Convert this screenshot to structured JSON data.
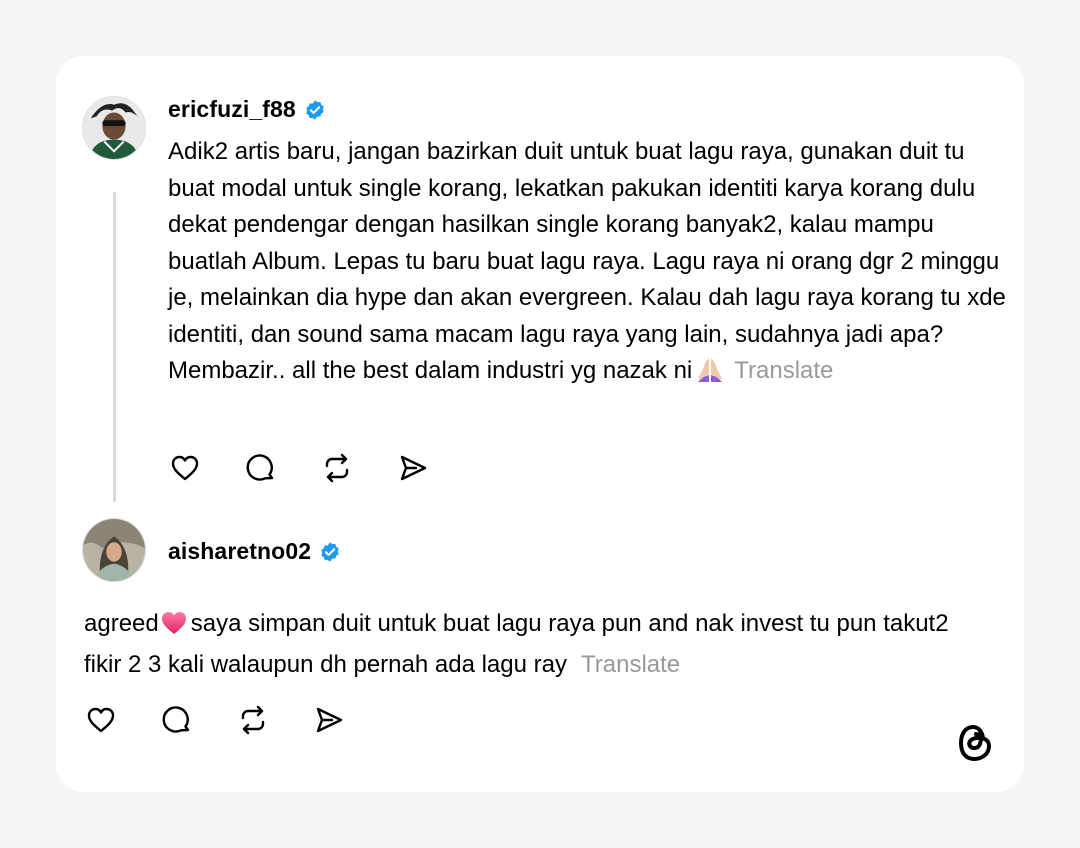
{
  "post": {
    "username": "ericfuzi_f88",
    "text": "Adik2 artis baru, jangan bazirkan duit untuk buat lagu raya, gunakan duit tu buat modal untuk single korang, lekatkan pakukan identiti karya korang dulu dekat pendengar dengan hasilkan single korang banyak2, kalau mampu buatlah Album. Lepas tu baru buat lagu raya. Lagu raya ni orang dgr 2 minggu je, melainkan dia hype dan akan evergreen. Kalau dah lagu raya korang tu xde identiti, dan sound sama macam lagu raya yang lain, sudahnya jadi apa? Membazir.. all the best dalam industri yg nazak ni",
    "emoji": "🙏🏻",
    "translate_label": "Translate"
  },
  "reply": {
    "username": "aisharetno02",
    "text_before_emoji": "agreed",
    "emoji": "💗",
    "text_after_emoji": "saya simpan duit untuk buat lagu raya pun and nak invest tu pun takut2 fikir 2 3 kali walaupun dh pernah ada lagu ray",
    "translate_label": "Translate"
  },
  "icons": {
    "like": "heart-icon",
    "comment": "comment-bubble-icon",
    "repost": "repost-icon",
    "share": "send-icon",
    "verified": "verified-badge-icon",
    "brand": "threads-logo-icon"
  },
  "colors": {
    "verified": "#1d9bf0",
    "text": "#000000",
    "muted": "#999999",
    "thread_line": "#d9d9d9",
    "background": "#f5f5f5",
    "card": "#ffffff"
  }
}
